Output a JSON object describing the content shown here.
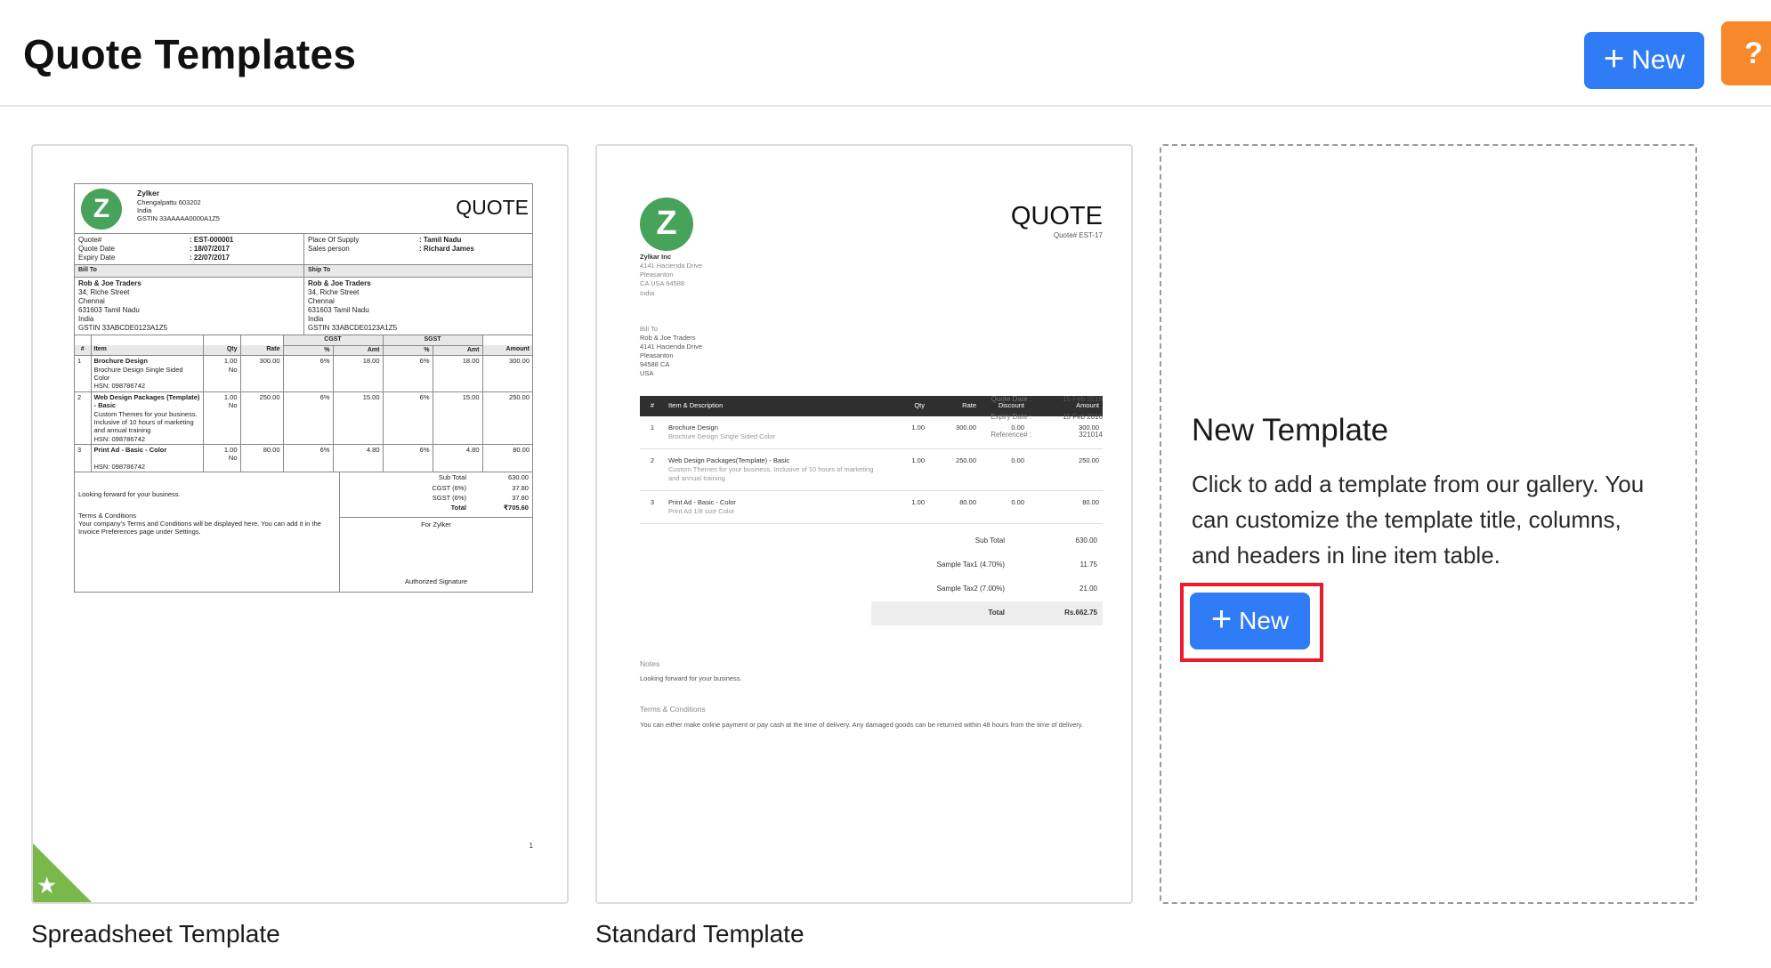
{
  "header": {
    "title": "Quote Templates",
    "new_button": "New",
    "help_button": "?"
  },
  "templates": [
    {
      "caption": "Spreadsheet Template",
      "favorite": true,
      "preview": {
        "logo_letter": "Z",
        "company": "Zylker",
        "address": [
          "Chengalpattu 603202",
          "India",
          "GSTIN 33AAAAA0000A1Z5"
        ],
        "doc_title": "QUOTE",
        "meta_left": [
          {
            "label": "Quote#",
            "value": ": EST-000001"
          },
          {
            "label": "Quote Date",
            "value": ": 18/07/2017"
          },
          {
            "label": "Expiry Date",
            "value": ": 22/07/2017"
          }
        ],
        "meta_right": [
          {
            "label": "Place Of Supply",
            "value": ": Tamil Nadu"
          },
          {
            "label": "Sales person",
            "value": ": Richard James"
          }
        ],
        "bill_to_label": "Bill To",
        "ship_to_label": "Ship To",
        "bill_to": [
          "Rob & Joe Traders",
          "34, Riche Street",
          "Chennai",
          "631603 Tamil Nadu",
          "India",
          "GSTIN 33ABCDE0123A1Z5"
        ],
        "ship_to": [
          "Rob & Joe Traders",
          "34, Riche Street",
          "Chennai",
          "631603 Tamil Nadu",
          "India",
          "GSTIN 33ABCDE0123A1Z5"
        ],
        "group_headers": {
          "cgst": "CGST",
          "sgst": "SGST"
        },
        "columns": [
          "#",
          "Item",
          "Qty",
          "Rate",
          "%",
          "Amt",
          "%",
          "Amt",
          "Amount"
        ],
        "rows": [
          {
            "no": "1",
            "item": "Brochure Design",
            "desc": "Brochure Design Single Sided Color",
            "hsn": "HSN: 098786742",
            "qty": "1.00",
            "unit": "No",
            "rate": "300.00",
            "cgst_pct": "6%",
            "cgst_amt": "18.00",
            "sgst_pct": "6%",
            "sgst_amt": "18.00",
            "amount": "300.00"
          },
          {
            "no": "2",
            "item": "Web Design Packages (Template) - Basic",
            "desc": "Custom Themes for your business. Inclusive of 10 hours of marketing and annual training",
            "hsn": "HSN: 098786742",
            "qty": "1.00",
            "unit": "No",
            "rate": "250.00",
            "cgst_pct": "6%",
            "cgst_amt": "15.00",
            "sgst_pct": "6%",
            "sgst_amt": "15.00",
            "amount": "250.00"
          },
          {
            "no": "3",
            "item": "Print Ad - Basic - Color",
            "desc": "",
            "hsn": "HSN: 098786742",
            "qty": "1.00",
            "unit": "No",
            "rate": "80.00",
            "cgst_pct": "6%",
            "cgst_amt": "4.80",
            "sgst_pct": "6%",
            "sgst_amt": "4.80",
            "amount": "80.00"
          }
        ],
        "notes": "Looking forward for your business.",
        "terms_label": "Terms & Conditions",
        "terms": "Your company's Terms and Conditions will be displayed here. You can add it in the Invoice Preferences page under Settings.",
        "totals": [
          {
            "label": "Sub Total",
            "value": "630.00"
          },
          {
            "label": "CGST (6%)",
            "value": "37.80"
          },
          {
            "label": "SGST (6%)",
            "value": "37.80"
          },
          {
            "label": "Total",
            "value": "₹705.60"
          }
        ],
        "for_company": "For Zylker",
        "signature": "Authorized Signature",
        "page_number": "1"
      }
    },
    {
      "caption": "Standard Template",
      "favorite": false,
      "preview": {
        "logo_letter": "Z",
        "doc_title": "QUOTE",
        "quote_no": "Quote# EST-17",
        "company": "Zylkar Inc",
        "address": [
          "4141 Hacienda Drive",
          "Pleasanton",
          "CA USA 94588",
          "India"
        ],
        "bill_to_label": "Bill To",
        "bill_to": [
          "Rob & Joe Traders",
          "4141 Hacienda Drive",
          "Pleasanton",
          "94588 CA",
          "USA"
        ],
        "dates": [
          {
            "label": "Quote Date :",
            "value": "15 Feb 2016"
          },
          {
            "label": "Expiry Date :",
            "value": "15 Feb 2016"
          },
          {
            "label": "Reference# :",
            "value": "321014"
          }
        ],
        "columns": [
          "#",
          "Item & Description",
          "Qty",
          "Rate",
          "Discount",
          "Amount"
        ],
        "rows": [
          {
            "no": "1",
            "item": "Brochure Design",
            "desc": "Brochure Design Single Sided Color",
            "qty": "1.00",
            "rate": "300.00",
            "discount": "0.00",
            "amount": "300.00"
          },
          {
            "no": "2",
            "item": "Web Design Packages(Template) - Basic",
            "desc": "Custom Themes for your business. Inclusive of 10 hours of marketing and annual training",
            "qty": "1.00",
            "rate": "250.00",
            "discount": "0.00",
            "amount": "250.00"
          },
          {
            "no": "3",
            "item": "Print Ad - Basic - Color",
            "desc": "Print Ad 1/8 size Color",
            "qty": "1.00",
            "rate": "80.00",
            "discount": "0.00",
            "amount": "80.00"
          }
        ],
        "totals": [
          {
            "label": "Sub Total",
            "value": "630.00"
          },
          {
            "label": "Sample Tax1 (4.70%)",
            "value": "11.75"
          },
          {
            "label": "Sample Tax2 (7.00%)",
            "value": "21.00"
          }
        ],
        "grand_total": {
          "label": "Total",
          "value": "Rs.662.75"
        },
        "notes_label": "Notes",
        "notes": "Looking forward for your business.",
        "terms_label": "Terms & Conditions",
        "terms": "You can either make online payment or pay cash at the time of delivery. Any damaged goods can be returned within 48 hours from the time of delivery."
      }
    }
  ],
  "new_template": {
    "title": "New Template",
    "description": "Click to add a template from our gallery. You can customize the template title, columns, and headers in line item table.",
    "button": "New"
  },
  "colors": {
    "primary_button": "#2f7cf6",
    "help_button": "#f7892c",
    "highlight": "#ec1c2a",
    "logo_green": "#47a35a",
    "favorite_green": "#79b84a"
  }
}
